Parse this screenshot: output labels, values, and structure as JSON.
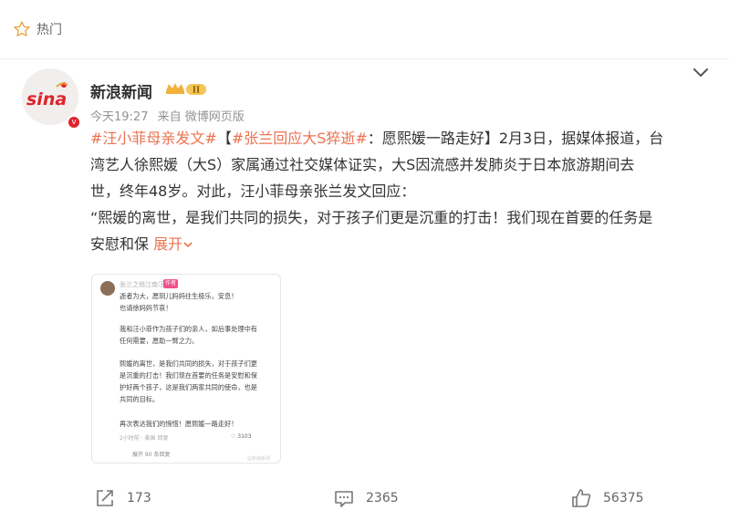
{
  "header": {
    "label": "热门",
    "icon": "star-outline-icon"
  },
  "post": {
    "author": "新浪新闻",
    "avatar_text": "sina",
    "verified_badge": "v",
    "level_badge": "II",
    "time": "今天19:27",
    "source": "来自 微博网页版",
    "content": {
      "topic1": "#汪小菲母亲发文#",
      "bracket_open": "【",
      "topic2": "#张兰回应大S猝逝#",
      "line1_rest": "：愿熙媛一路走好】2月3日，据媒体报道，台",
      "line2": "湾艺人徐熙媛（大S）家属通过社交媒体证实，大S因流感并发肺炎于日本旅游期间去",
      "line3": "世，终年48岁。对此，汪小菲母亲张兰发文回应：",
      "line4": "“熙媛的离世，是我们共同的损失，对于孩子们更是沉重的打击！我们现在首要的任务是",
      "line5": "安慰和保",
      "expand": "展开"
    },
    "thumbnail": {
      "name": "张兰之俏江南汪",
      "tag": "作者",
      "para1": "逝者为大，愿玥儿妈妈往生极乐，安息！\n也请徐妈妈节哀！",
      "para2": "我和汪小菲作为孩子们的亲人，如后事处理中有\n任何需要，愿助一臂之力。",
      "para3": "熙媛的离世，是我们共同的损失，对于孩子们更\n是沉重的打击！我们现在首要的任务是安慰和保\n护好两个孩子，这是我们两家共同的使命，也是\n共同的目标。",
      "para4": "再次表达我们的惋惜！愿熙媛一路走好！",
      "foot": "2小时前 · 泰国    回复",
      "likes": "3103",
      "more": "展开 90 条回复",
      "watermark": "@新浪新闻"
    },
    "actions": {
      "share": "173",
      "comment": "2365",
      "like": "56375"
    }
  },
  "colors": {
    "accent": "#eb7350",
    "brand": "#e0222b",
    "muted": "#939393"
  }
}
